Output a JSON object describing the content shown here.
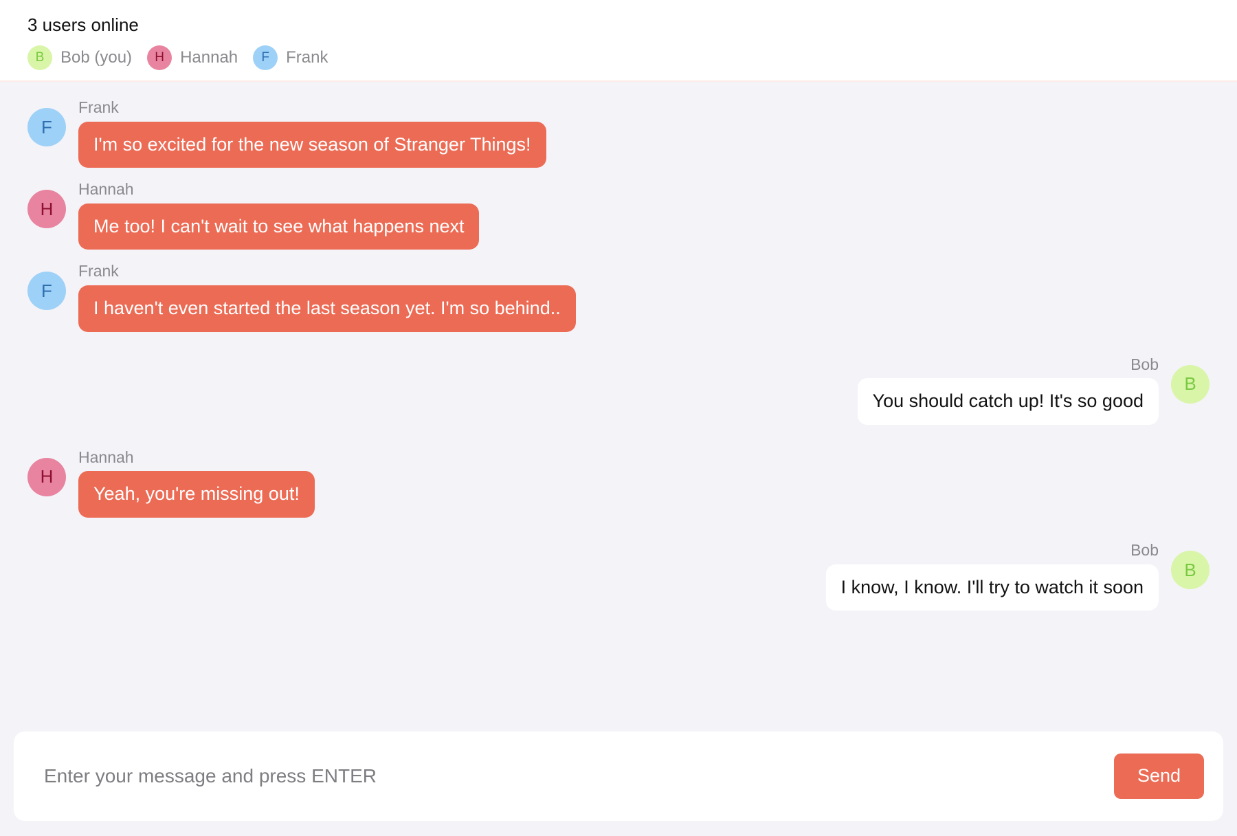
{
  "header": {
    "online_status": "3 users online",
    "users": [
      {
        "initial": "B",
        "label": "Bob (you)",
        "bg": "#d9f5a8",
        "fg": "#7ac943"
      },
      {
        "initial": "H",
        "label": "Hannah",
        "bg": "#e8849f",
        "fg": "#8e1030"
      },
      {
        "initial": "F",
        "label": "Frank",
        "bg": "#9ed1f7",
        "fg": "#2f6fb0"
      }
    ]
  },
  "messages": [
    {
      "author": "Frank",
      "text": "I'm so excited for the new season of Stranger Things!",
      "direction": "incoming",
      "initial": "F",
      "bg": "#9ed1f7",
      "fg": "#2f6fb0"
    },
    {
      "author": "Hannah",
      "text": "Me too! I can't wait to see what happens next",
      "direction": "incoming",
      "initial": "H",
      "bg": "#e8849f",
      "fg": "#8e1030"
    },
    {
      "author": "Frank",
      "text": "I haven't even started the last season yet. I'm so behind..",
      "direction": "incoming",
      "initial": "F",
      "bg": "#9ed1f7",
      "fg": "#2f6fb0"
    },
    {
      "author": "Bob",
      "text": "You should catch up! It's so good",
      "direction": "outgoing",
      "initial": "B",
      "bg": "#d9f5a8",
      "fg": "#7ac943"
    },
    {
      "author": "Hannah",
      "text": "Yeah, you're missing out!",
      "direction": "incoming",
      "initial": "H",
      "bg": "#e8849f",
      "fg": "#8e1030"
    },
    {
      "author": "Bob",
      "text": "I know, I know. I'll try to watch it soon",
      "direction": "outgoing",
      "initial": "B",
      "bg": "#d9f5a8",
      "fg": "#7ac943"
    }
  ],
  "composer": {
    "placeholder": "Enter your message and press ENTER",
    "value": "",
    "send_label": "Send"
  },
  "colors": {
    "accent": "#ec6b55",
    "page_background": "#f4f3f8",
    "panel_background": "#ffffff",
    "muted_text": "#8a8a8e"
  }
}
